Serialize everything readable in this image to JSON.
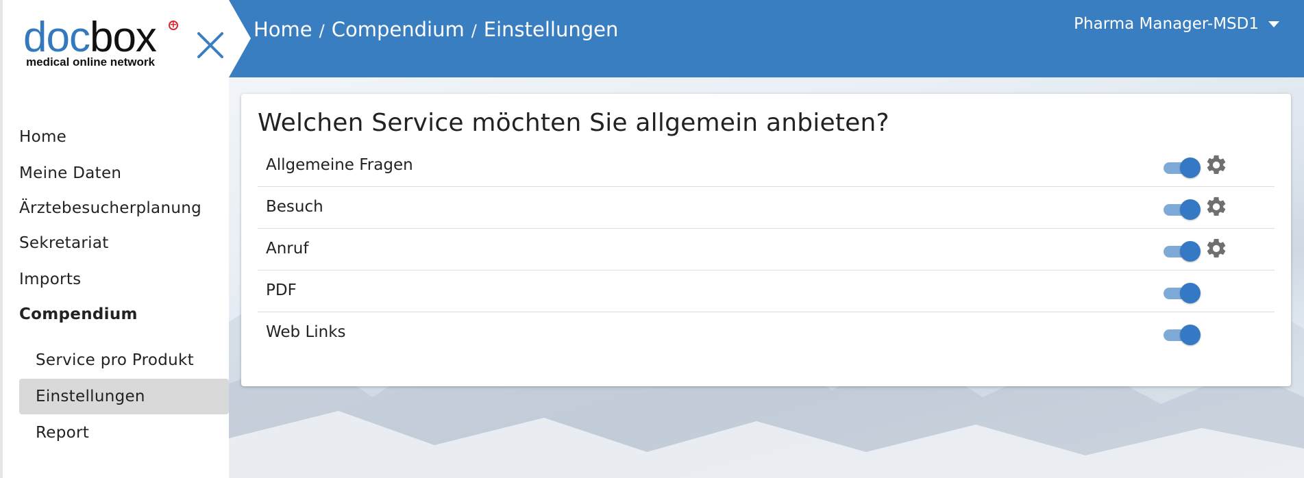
{
  "logo": {
    "doc": "doc",
    "box": "box",
    "plus": "+",
    "tagline": "medical online network"
  },
  "sidebar": {
    "items": [
      {
        "label": "Home"
      },
      {
        "label": "Meine Daten"
      },
      {
        "label": "Ärztebesucherplanung"
      },
      {
        "label": "Sekretariat"
      },
      {
        "label": "Imports"
      },
      {
        "label": "Compendium"
      }
    ],
    "subitems": [
      {
        "label": "Service pro Produkt"
      },
      {
        "label": "Einstellungen"
      },
      {
        "label": "Report"
      }
    ]
  },
  "header": {
    "breadcrumb": [
      "Home",
      "Compendium",
      "Einstellungen"
    ],
    "separator": "/",
    "user": "Pharma Manager-MSD1"
  },
  "card": {
    "title": "Welchen Service möchten Sie allgemein anbieten?",
    "rows": [
      {
        "label": "Allgemeine Fragen",
        "enabled": true,
        "has_settings": true
      },
      {
        "label": "Besuch",
        "enabled": true,
        "has_settings": true
      },
      {
        "label": "Anruf",
        "enabled": true,
        "has_settings": true
      },
      {
        "label": "PDF",
        "enabled": true,
        "has_settings": false
      },
      {
        "label": "Web Links",
        "enabled": true,
        "has_settings": false
      }
    ]
  },
  "colors": {
    "brand_blue": "#3a7ec2",
    "toggle_knob": "#3578c3",
    "toggle_track": "#7eaad8",
    "logo_red": "#d8242c"
  },
  "icons": {
    "close": "close-icon",
    "gear": "gear-icon",
    "dropdown": "chevron-down-icon"
  }
}
